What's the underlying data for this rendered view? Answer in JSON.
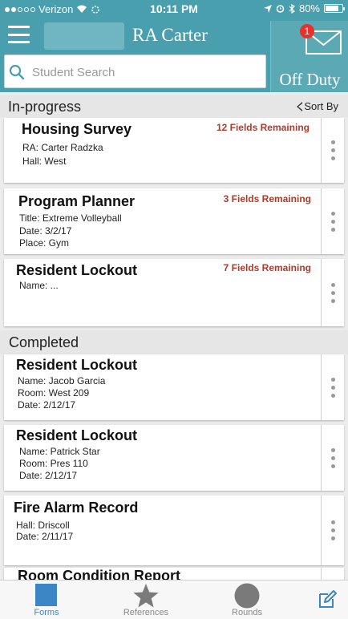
{
  "status_bar": {
    "carrier": "Verizon",
    "time": "10:11 PM",
    "battery": "80%",
    "battery_level": 0.8
  },
  "header": {
    "title": "RA Carter",
    "menu_icon": "hamburger-menu-icon",
    "mail_badge": "1",
    "duty_label": "Off Duty"
  },
  "search": {
    "placeholder": "Student Search",
    "value": ""
  },
  "sections": {
    "in_progress": {
      "title": "In-progress",
      "sort_label": "Sort By",
      "items": [
        {
          "title": "Housing Survey",
          "remaining": "12 Fields Remaining",
          "lines": [
            "RA: Carter Radzka",
            "Hall: West"
          ]
        },
        {
          "title": "Program Planner",
          "remaining": "3 Fields Remaining",
          "lines": [
            "Title: Extreme Volleyball",
            "Date: 3/2/17",
            "Place: Gym"
          ]
        },
        {
          "title": "Resident Lockout",
          "remaining": "7 Fields Remaining",
          "lines": [
            "Name: ..."
          ]
        }
      ]
    },
    "completed": {
      "title": "Completed",
      "items": [
        {
          "title": "Resident Lockout",
          "lines": [
            "Name: Jacob Garcia",
            "Room: West 209",
            "Date: 2/12/17"
          ]
        },
        {
          "title": "Resident Lockout",
          "lines": [
            "Name: Patrick Star",
            "Room: Pres 110",
            "Date: 2/12/17"
          ]
        },
        {
          "title": "Fire Alarm Record",
          "lines": [
            "Hall: Driscoll",
            "Date: 2/11/17"
          ]
        },
        {
          "title": "Room Condition Report"
        }
      ]
    }
  },
  "tabbar": {
    "forms": "Forms",
    "references": "References",
    "rounds": "Rounds"
  },
  "colors": {
    "header": "#4a9fae",
    "remaining": "#b13a2b",
    "tab_active": "#3c86c6",
    "badge": "#e8312a"
  }
}
